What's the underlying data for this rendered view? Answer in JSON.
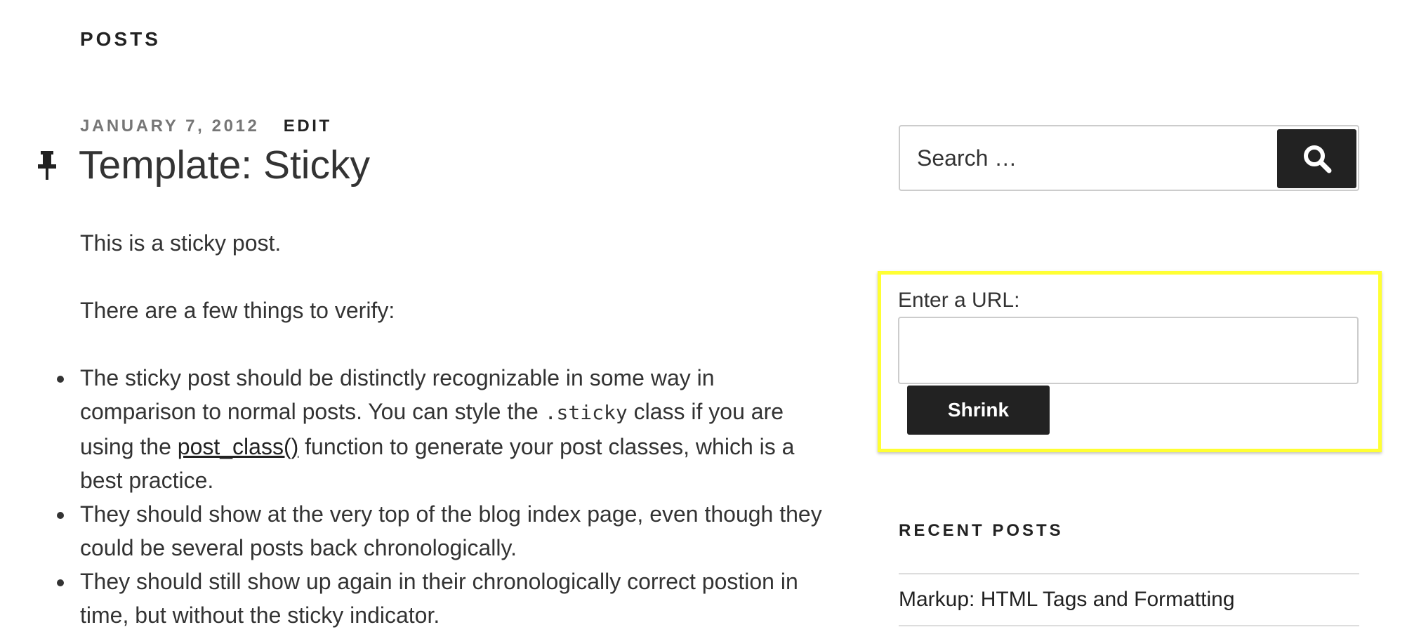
{
  "page": {
    "heading": "POSTS"
  },
  "post": {
    "date": "JANUARY 7, 2012",
    "edit_label": "EDIT",
    "pin_icon": "pushpin-icon",
    "title": "Template: Sticky",
    "para1": "This is a sticky post.",
    "para2": "There are a few things to verify:",
    "bullet1_a": "The sticky post should be distinctly recognizable in some way in comparison to normal posts. You can style the ",
    "bullet1_code": ".sticky",
    "bullet1_b": " class if you are using the ",
    "bullet1_link": "post_class()",
    "bullet1_c": " function to generate your post classes, which is a best practice.",
    "bullet2": "They should show at the very top of the blog index page, even though they could be several posts back chronologically.",
    "bullet3": "They should still show up again in their chronologically correct postion in time, but without the sticky indicator."
  },
  "sidebar": {
    "search": {
      "placeholder": "Search …",
      "icon": "search-icon"
    },
    "url_widget": {
      "label": "Enter a URL:",
      "input_value": "",
      "button_label": "Shrink",
      "highlight_color": "#ffff33"
    },
    "recent": {
      "title": "RECENT POSTS",
      "items": [
        {
          "label": "Markup: HTML Tags and Formatting"
        }
      ]
    }
  },
  "colors": {
    "text": "#222222",
    "meta_gray": "#767676",
    "button_bg": "#222222",
    "border": "#cccccc"
  }
}
